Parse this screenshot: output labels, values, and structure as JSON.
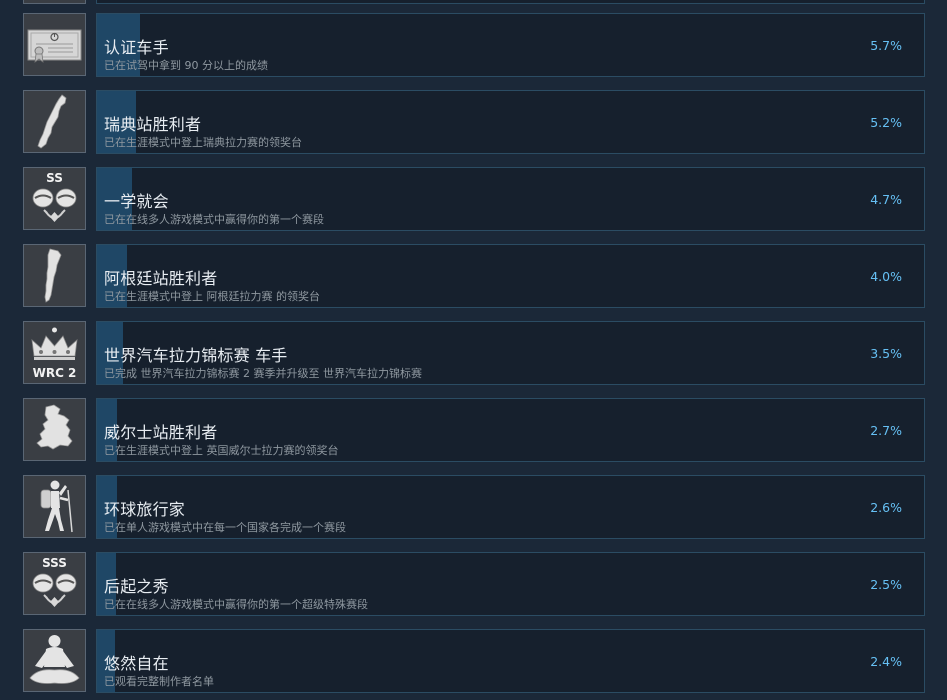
{
  "achievements": [
    {
      "title": "认证车手",
      "desc": "已在试驾中拿到 90 分以上的成绩",
      "percent": "5.7%",
      "progress": 5.7,
      "icon": "certificate-icon"
    },
    {
      "title": "瑞典站胜利者",
      "desc": "已在生涯模式中登上瑞典拉力赛的领奖台",
      "percent": "5.2%",
      "progress": 5.2,
      "icon": "sweden-map-icon"
    },
    {
      "title": "一学就会",
      "desc": "已在在线多人游戏模式中赢得你的第一个赛段",
      "percent": "4.7%",
      "progress": 4.7,
      "icon": "ss-helmets-icon",
      "badge": "SS"
    },
    {
      "title": "阿根廷站胜利者",
      "desc": "已在生涯模式中登上 阿根廷拉力赛 的领奖台",
      "percent": "4.0%",
      "progress": 4.0,
      "icon": "argentina-map-icon"
    },
    {
      "title": "世界汽车拉力锦标赛 车手",
      "desc": "已完成 世界汽车拉力锦标赛 2 赛季并升级至 世界汽车拉力锦标赛",
      "percent": "3.5%",
      "progress": 3.5,
      "icon": "wrc2-crown-icon",
      "badge": "WRC 2"
    },
    {
      "title": "威尔士站胜利者",
      "desc": "已在生涯模式中登上 英国威尔士拉力赛的领奖台",
      "percent": "2.7%",
      "progress": 2.7,
      "icon": "wales-map-icon"
    },
    {
      "title": "环球旅行家",
      "desc": "已在单人游戏模式中在每一个国家各完成一个赛段",
      "percent": "2.6%",
      "progress": 2.6,
      "icon": "hiker-icon"
    },
    {
      "title": "后起之秀",
      "desc": "已在在线多人游戏模式中赢得你的第一个超级特殊赛段",
      "percent": "2.5%",
      "progress": 2.5,
      "icon": "sss-helmets-icon",
      "badge": "SSS"
    },
    {
      "title": "悠然自在",
      "desc": "已观看完整制作者名单",
      "percent": "2.4%",
      "progress": 2.4,
      "icon": "meditation-icon"
    }
  ]
}
